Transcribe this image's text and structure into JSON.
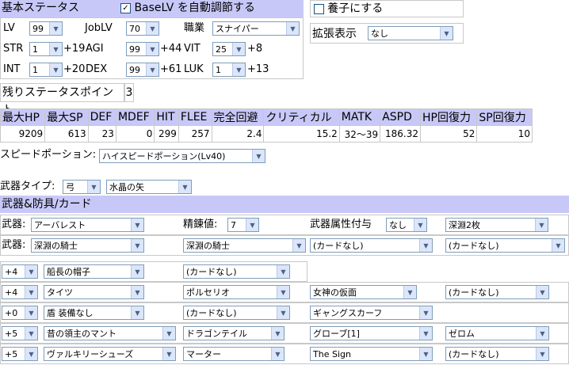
{
  "basic": {
    "header": "基本ステータス",
    "auto_adjust_label": "BaseLV を自動調節する",
    "auto_adjust_checked": true,
    "adopt_label": "養子にする",
    "adopt_checked": false,
    "ext_label": "拡張表示",
    "ext_value": "なし",
    "lv_label": "LV",
    "lv": "99",
    "joblv_label": "JobLV",
    "joblv": "70",
    "job_label": "職業",
    "job": "スナイパー",
    "str_label": "STR",
    "str": "1",
    "str_bonus": "+19",
    "agi_label": "AGI",
    "agi": "99",
    "agi_bonus": "+44",
    "vit_label": "VIT",
    "vit": "25",
    "vit_bonus": "+8",
    "int_label": "INT",
    "int": "1",
    "int_bonus": "+20",
    "dex_label": "DEX",
    "dex": "99",
    "dex_bonus": "+61",
    "luk_label": "LUK",
    "luk": "1",
    "luk_bonus": "+13",
    "remaining_label": "残りステータスポイント",
    "remaining_value": "3"
  },
  "stats": {
    "headers": [
      "最大HP",
      "最大SP",
      "DEF",
      "MDEF",
      "HIT",
      "FLEE",
      "完全回避",
      "クリティカル",
      "MATK",
      "ASPD",
      "HP回復力",
      "SP回復力"
    ],
    "values": [
      "9209",
      "613",
      "23",
      "0",
      "299",
      "257",
      "2.4",
      "15.2",
      "32〜39",
      "186.32",
      "52",
      "10"
    ]
  },
  "speed": {
    "label": "スピードポーション:",
    "value": "ハイスピードポーション(Lv40)"
  },
  "weapon_type": {
    "label": "武器タイプ:",
    "type": "弓",
    "arrow": "水晶の矢"
  },
  "equip": {
    "header": "武器&防具/カード",
    "w1_label": "武器:",
    "w1": "アーバレスト",
    "refine_label": "精錬値:",
    "refine": "7",
    "element_label": "武器属性付与",
    "element": "なし",
    "w1_card": "深淵2枚",
    "w2_label": "武器:",
    "w2": "深淵の騎士",
    "w2_card1": "深淵の騎士",
    "w2_card2": "(カードなし)",
    "w2_card3": "(カードなし)",
    "rows": [
      {
        "refine": "+4",
        "item": "船長の帽子",
        "c1": "(カードなし)"
      },
      {
        "refine": "+4",
        "item": "タイツ",
        "c1": "ポルセリオ",
        "c2": "女神の仮面",
        "c3": "(カードなし)"
      },
      {
        "refine": "+0",
        "item": "盾 装備なし",
        "c1": "(カードなし)",
        "c2": "ギャングスカーフ"
      },
      {
        "refine": "+5",
        "item": "昔の領主のマント",
        "c1": "ドラゴンテイル",
        "c2": "グローブ[1]",
        "c3": "ゼロム"
      },
      {
        "refine": "+5",
        "item": "ヴァルキリーシューズ",
        "c1": "マーター",
        "c2": "The Sign",
        "c3": "(カードなし)"
      }
    ]
  },
  "colors": {
    "header_bg": "#c8c8f8",
    "select_border": "#7f9db9"
  }
}
